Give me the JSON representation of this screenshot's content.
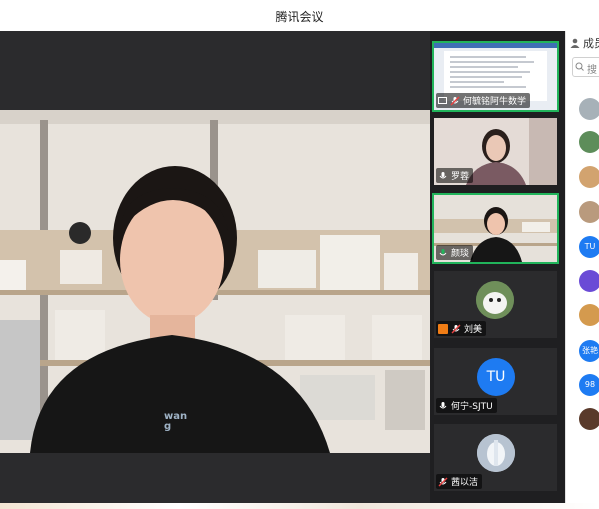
{
  "window": {
    "title": "腾讯会议"
  },
  "speaker": {
    "shirt_text": "wang"
  },
  "tiles": [
    {
      "name": "何毓铭阿牛数学"
    },
    {
      "name": "罗蓉"
    },
    {
      "name": "颜琰"
    },
    {
      "name": "刘美"
    },
    {
      "name": "何宁-SJTU",
      "initials": "TU"
    },
    {
      "name": "茜以洁"
    }
  ],
  "members": {
    "header": "成员",
    "search_placeholder": "搜",
    "items": [
      {
        "label": ""
      },
      {
        "label": ""
      },
      {
        "label": ""
      },
      {
        "label": ""
      },
      {
        "label": "TU"
      },
      {
        "label": ""
      },
      {
        "label": ""
      },
      {
        "label": "张艳"
      },
      {
        "label": "98"
      },
      {
        "label": ""
      }
    ]
  },
  "colors": {
    "accent_green": "#21b45b",
    "avatar_blue": "#1e7bf2"
  }
}
